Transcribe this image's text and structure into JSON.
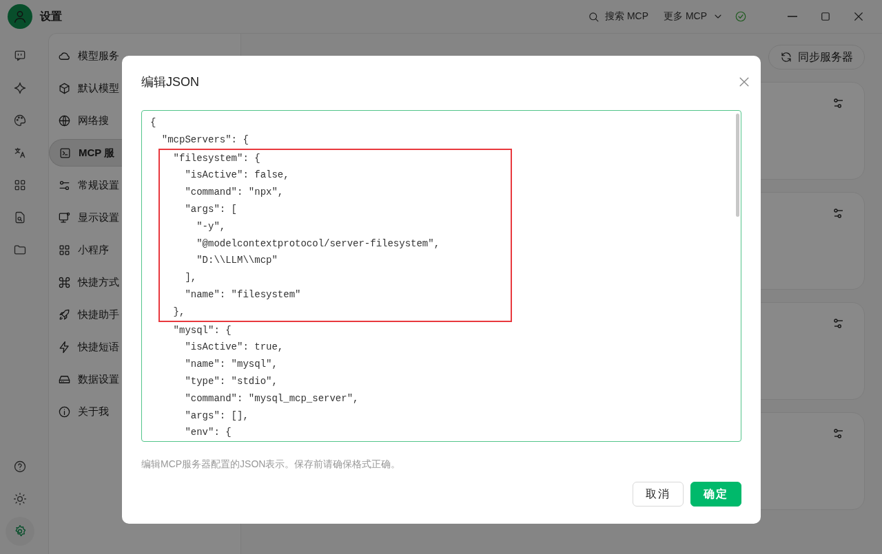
{
  "window": {
    "title": "设置"
  },
  "top_actions": {
    "search": "搜索 MCP",
    "more": "更多 MCP"
  },
  "rail": {
    "top": [
      {
        "selected": false
      },
      {
        "selected": false
      },
      {
        "selected": false
      },
      {
        "selected": false
      },
      {
        "selected": false
      },
      {
        "selected": false
      },
      {
        "selected": false
      }
    ],
    "bottom": [
      {
        "selected": false
      },
      {
        "selected": false
      },
      {
        "selected": true
      }
    ]
  },
  "nav": {
    "items": [
      {
        "label": "模型服务",
        "selected": false
      },
      {
        "label": "默认模型",
        "selected": false
      },
      {
        "label": "网络搜",
        "selected": false
      },
      {
        "label": "MCP 服",
        "selected": true
      },
      {
        "label": "常规设置",
        "selected": false
      },
      {
        "label": "显示设置",
        "selected": false
      },
      {
        "label": "小程序",
        "selected": false
      },
      {
        "label": "快捷方式",
        "selected": false
      },
      {
        "label": "快捷助手",
        "selected": false
      },
      {
        "label": "快捷短语",
        "selected": false
      },
      {
        "label": "数据设置",
        "selected": false
      },
      {
        "label": "关于我",
        "selected": false
      }
    ]
  },
  "content": {
    "sync_button": "同步服务器"
  },
  "dialog": {
    "title": "编辑JSON",
    "editor": {
      "lines": [
        {
          "text": "{",
          "highlighted": false
        },
        {
          "text": "  \"mcpServers\": {",
          "highlighted": false
        },
        {
          "text": "    \"filesystem\": {",
          "highlighted": true
        },
        {
          "text": "      \"isActive\": false,",
          "highlighted": true
        },
        {
          "text": "      \"command\": \"npx\",",
          "highlighted": true
        },
        {
          "text": "      \"args\": [",
          "highlighted": true
        },
        {
          "text": "        \"-y\",",
          "highlighted": true
        },
        {
          "text": "        \"@modelcontextprotocol/server-filesystem\",",
          "highlighted": true
        },
        {
          "text": "        \"D:\\\\LLM\\\\mcp\"",
          "highlighted": true
        },
        {
          "text": "      ],",
          "highlighted": true
        },
        {
          "text": "      \"name\": \"filesystem\"",
          "highlighted": true
        },
        {
          "text": "    },",
          "highlighted": true
        },
        {
          "text": "    \"mysql\": {",
          "highlighted": false
        },
        {
          "text": "      \"isActive\": true,",
          "highlighted": false
        },
        {
          "text": "      \"name\": \"mysql\",",
          "highlighted": false
        },
        {
          "text": "      \"type\": \"stdio\",",
          "highlighted": false
        },
        {
          "text": "      \"command\": \"mysql_mcp_server\",",
          "highlighted": false
        },
        {
          "text": "      \"args\": [],",
          "highlighted": false
        },
        {
          "text": "      \"env\": {",
          "highlighted": false
        }
      ]
    },
    "hint": "编辑MCP服务器配置的JSON表示。保存前请确保格式正确。",
    "buttons": [
      {
        "label": "取消",
        "kind": "secondary"
      },
      {
        "label": "确定",
        "kind": "primary"
      }
    ]
  }
}
